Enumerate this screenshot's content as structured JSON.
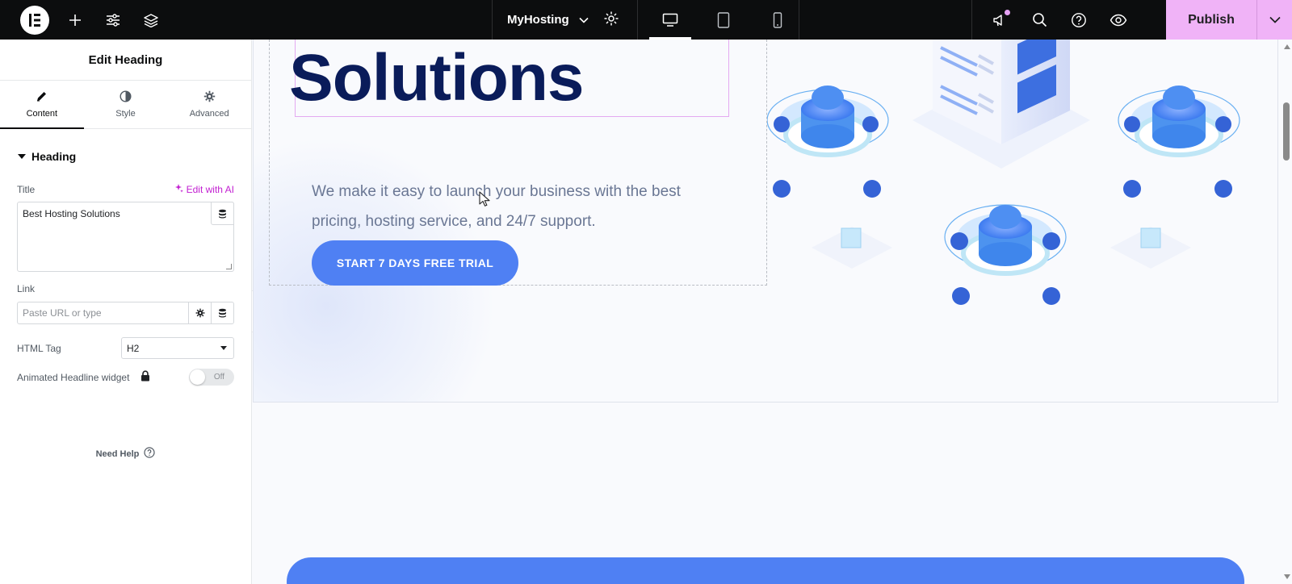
{
  "topbar": {
    "logo_icon": "elementor-logo-icon",
    "site_name": "MyHosting",
    "publish_label": "Publish"
  },
  "panel": {
    "title": "Edit Heading",
    "tabs": [
      {
        "label": "Content",
        "icon": "pencil-icon",
        "active": true
      },
      {
        "label": "Style",
        "icon": "half-circle-icon",
        "active": false
      },
      {
        "label": "Advanced",
        "icon": "gear-icon",
        "active": false
      }
    ],
    "section_heading": "Heading",
    "title_label": "Title",
    "edit_with_ai": "Edit with AI",
    "title_value": "Best Hosting Solutions",
    "link_label": "Link",
    "link_placeholder": "Paste URL or type",
    "html_tag_label": "HTML Tag",
    "html_tag_value": "H2",
    "animated_label": "Animated Headline widget",
    "toggle_label": "Off",
    "need_help": "Need Help"
  },
  "canvas": {
    "heading": "Solutions",
    "subtext": "We make it easy to launch your business with the best pricing, hosting service, and 24/7 support.",
    "cta_label": "START 7 DAYS FREE TRIAL"
  },
  "colors": {
    "accent": "#4f80f3",
    "heading": "#0a1c5a",
    "publish_bg": "#f0b3f7",
    "ai_magenta": "#c21fd1",
    "topbar_bg": "#0c0d0e"
  }
}
